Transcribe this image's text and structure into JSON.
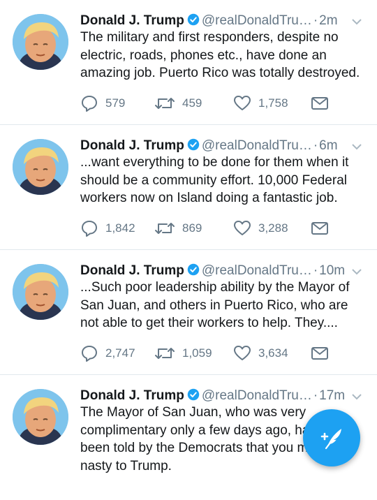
{
  "tweets": [
    {
      "name": "Donald J. Trump",
      "handle": "@realDonaldTru…",
      "time": "2m",
      "text": "The military and first responders, despite no electric, roads, phones etc., have done an amazing job. Puerto Rico was totally destroyed.",
      "replies": "579",
      "retweets": "459",
      "likes": "1,758"
    },
    {
      "name": "Donald J. Trump",
      "handle": "@realDonaldTru…",
      "time": "6m",
      "text": "...want everything to be done for them when it should be a community effort. 10,000 Federal workers now on Island doing a fantastic job.",
      "replies": "1,842",
      "retweets": "869",
      "likes": "3,288"
    },
    {
      "name": "Donald J. Trump",
      "handle": "@realDonaldTru…",
      "time": "10m",
      "text": "...Such poor leadership ability by the Mayor of San Juan, and others in Puerto Rico, who are not able to get their workers to help. They....",
      "replies": "2,747",
      "retweets": "1,059",
      "likes": "3,634"
    },
    {
      "name": "Donald J. Trump",
      "handle": "@realDonaldTru…",
      "time": "17m",
      "text": "The Mayor of San Juan, who was very complimentary only a few days ago, has now been told by the Democrats that you must be nasty to Trump."
    }
  ],
  "separator": "·",
  "colors": {
    "accent": "#1da1f2",
    "secondary_text": "#657786",
    "divider": "#e1e8ed"
  },
  "icons": {
    "reply": "reply-icon",
    "retweet": "retweet-icon",
    "like": "heart-icon",
    "dm": "envelope-icon",
    "verified": "verified-badge-icon",
    "caret": "chevron-down-icon",
    "compose": "compose-tweet-icon"
  }
}
